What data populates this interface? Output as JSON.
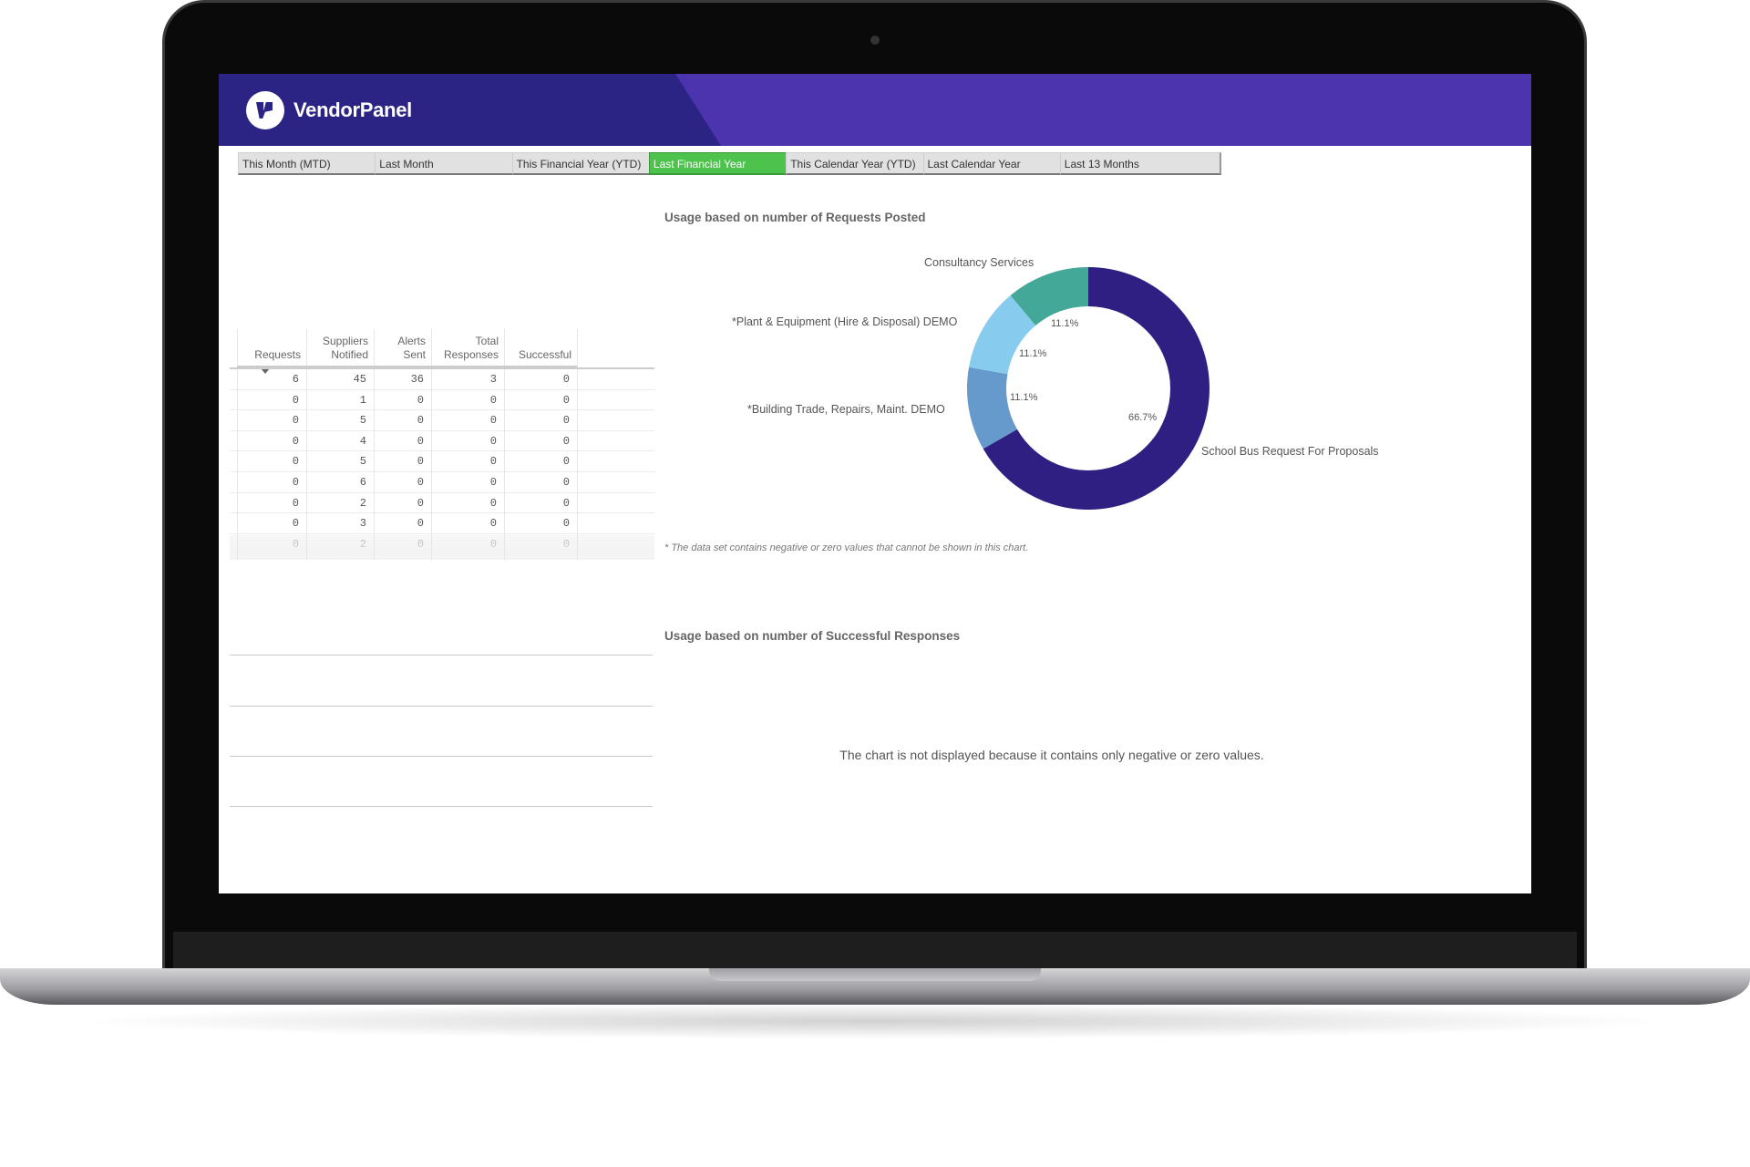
{
  "brand": {
    "name": "VendorPanel",
    "colors": {
      "header_dark": "#2b2485",
      "header_light": "#4b34ae",
      "active_tab": "#4dc24d"
    }
  },
  "tabs": [
    {
      "label": "This Month (MTD)",
      "active": false
    },
    {
      "label": "Last Month",
      "active": false
    },
    {
      "label": "This Financial Year (YTD)",
      "active": false
    },
    {
      "label": "Last Financial Year",
      "active": true
    },
    {
      "label": "This Calendar Year (YTD)",
      "active": false
    },
    {
      "label": "Last Calendar Year",
      "active": false
    },
    {
      "label": "Last 13 Months",
      "active": false
    }
  ],
  "table": {
    "headers": [
      [
        "",
        "Requests"
      ],
      [
        "Suppliers",
        "Notified"
      ],
      [
        "Alerts",
        "Sent"
      ],
      [
        "Total",
        "Responses"
      ],
      [
        "",
        "Successful"
      ]
    ],
    "sort_icon": "triangle-down-icon",
    "rows": [
      [
        "6",
        "45",
        "36",
        "3",
        "0"
      ],
      [
        "0",
        "1",
        "0",
        "0",
        "0"
      ],
      [
        "0",
        "5",
        "0",
        "0",
        "0"
      ],
      [
        "0",
        "4",
        "0",
        "0",
        "0"
      ],
      [
        "0",
        "5",
        "0",
        "0",
        "0"
      ],
      [
        "0",
        "6",
        "0",
        "0",
        "0"
      ],
      [
        "0",
        "2",
        "0",
        "0",
        "0"
      ],
      [
        "0",
        "3",
        "0",
        "0",
        "0"
      ],
      [
        "0",
        "2",
        "0",
        "0",
        "0"
      ]
    ]
  },
  "chart_data": [
    {
      "type": "pie",
      "title": "Usage based on number of Requests Posted",
      "donut": true,
      "slices": [
        {
          "label": "School Bus Request For Proposals",
          "value": 66.7,
          "value_label": "66.7%",
          "color": "#2f1f82"
        },
        {
          "label": "*Building Trade, Repairs, Maint. DEMO",
          "value": 11.1,
          "value_label": "11.1%",
          "color": "#6699cc"
        },
        {
          "label": "*Plant & Equipment (Hire & Disposal) DEMO",
          "value": 11.1,
          "value_label": "11.1%",
          "color": "#87ccee"
        },
        {
          "label": "Consultancy Services",
          "value": 11.1,
          "value_label": "11.1%",
          "color": "#44a898"
        }
      ],
      "footnote": "* The data set contains negative or zero values that cannot be shown in this chart."
    },
    {
      "type": "pie",
      "title": "Usage based on number of Successful Responses",
      "message": "The chart is not displayed because it contains only negative or zero values."
    }
  ]
}
